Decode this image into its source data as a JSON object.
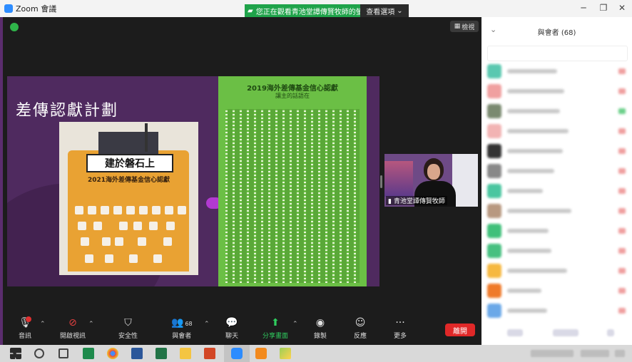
{
  "window": {
    "app_title": "Zoom 會議",
    "share_banner": "您正在觀看青池堂譚傳賢牧師的螢幕",
    "view_options": "查看選項",
    "gallery_label": "檢視"
  },
  "slide": {
    "title": "差傳認獻計劃",
    "orange_board_text": "建於磐石上",
    "orange_heading": "2021海外差傳基金信心認獻",
    "green_heading": "2019海外差傳基金信心認獻",
    "green_sub": "讓主的話語在"
  },
  "video": {
    "participant_name": "青池堂譚傳賢牧師"
  },
  "toolbar": {
    "audio": "音訊",
    "video": "開啟視訊",
    "security": "安全性",
    "participants": "與會者",
    "participant_count": "68",
    "chat": "聊天",
    "share": "分享畫面",
    "record": "錄製",
    "reactions": "反應",
    "more": "更多",
    "leave": "離開"
  },
  "panel": {
    "title": "與會者 (68)"
  },
  "colors": {
    "share_green": "#1fa34a",
    "leave_red": "#e02828",
    "slide_purple": "#4f2a5f",
    "frame_purple": "#5b2d6e"
  }
}
